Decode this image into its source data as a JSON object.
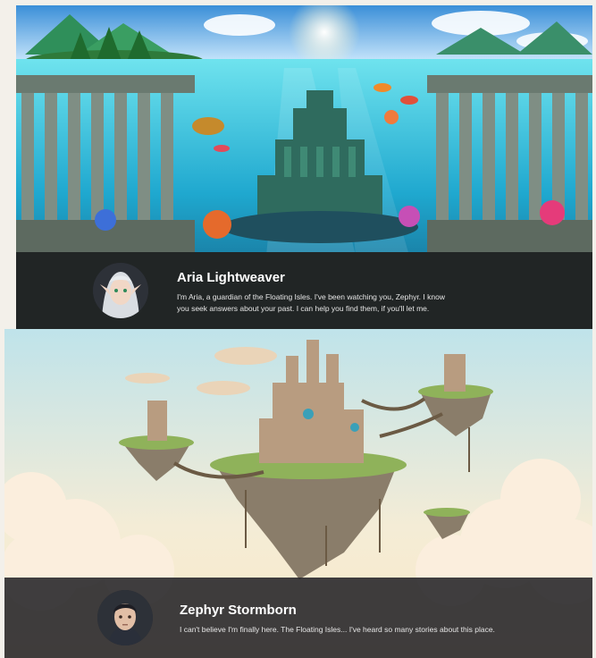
{
  "scene_top": {
    "name": "underwater-ruins-scene"
  },
  "scene_bottom": {
    "name": "floating-isles-scene"
  },
  "dialogs": [
    {
      "speaker": "Aria Lightweaver",
      "text": "I'm Aria, a guardian of the Floating Isles. I've been watching you, Zephyr. I know you seek answers about your past. I can help you find them, if you'll let me.",
      "portrait_icon": "elf-portrait-icon"
    },
    {
      "speaker": "Zephyr Stormborn",
      "text": "I can't believe I'm finally here. The Floating Isles... I've heard so many stories about this place.",
      "portrait_icon": "man-portrait-icon"
    }
  ],
  "colors": {
    "dialog_bg": "#202024",
    "sea": "#2bb3d6",
    "sky_top": "#bfe3ea",
    "sky_bottom": "#fbe9c7"
  }
}
